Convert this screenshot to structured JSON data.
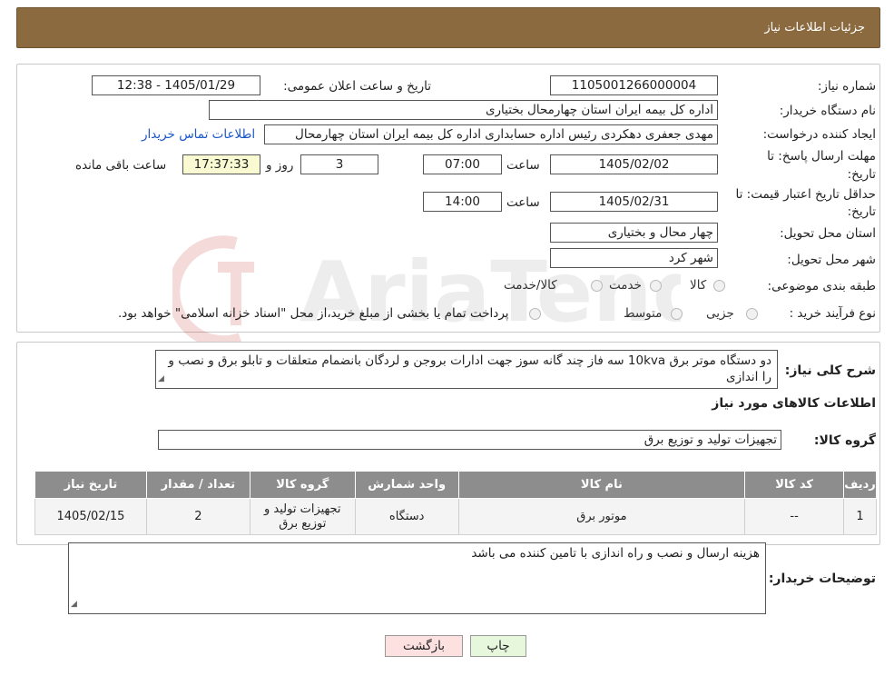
{
  "header": {
    "title": "جزئیات اطلاعات نیاز"
  },
  "form": {
    "need_number_label": "شماره نیاز:",
    "need_number": "1105001266000004",
    "announce_label": "تاریخ و ساعت اعلان عمومی:",
    "announce_value": "1405/01/29 - 12:38",
    "buyer_org_label": "نام دستگاه خریدار:",
    "buyer_org": "اداره کل بیمه ایران استان چهارمحال بختیاری",
    "creator_label": "ایجاد کننده درخواست:",
    "creator": "مهدی جعفری دهکردی رئیس اداره حسابداری اداره کل بیمه ایران استان چهارمحال",
    "contact_link": "اطلاعات تماس خریدار",
    "send_deadline_label_1": "مهلت ارسال پاسخ: تا",
    "send_deadline_label_2": "تاریخ:",
    "send_deadline_date": "1405/02/02",
    "time_label": "ساعت",
    "send_deadline_time": "07:00",
    "days_value": "3",
    "days_label": "روز و",
    "remaining_time": "17:37:33",
    "remaining_label": "ساعت باقی مانده",
    "price_validity_label_1": "حداقل تاریخ اعتبار قیمت: تا",
    "price_validity_label_2": "تاریخ:",
    "price_validity_date": "1405/02/31",
    "price_validity_time": "14:00",
    "province_label": "استان محل تحویل:",
    "province": "چهار محال و بختیاری",
    "city_label": "شهر محل تحویل:",
    "city": "شهر کرد",
    "category_label": "طبقه بندی موضوعی:",
    "category_options": [
      "کالا",
      "خدمت",
      "کالا/خدمت"
    ],
    "process_label": "نوع فرآیند خرید :",
    "process_options": [
      "جزیی",
      "متوسط"
    ],
    "process_note": "پرداخت تمام یا بخشی از مبلغ خرید،از محل \"اسناد خزانه اسلامی\" خواهد بود."
  },
  "description": {
    "label": "شرح کلی نیاز:",
    "text": "دو دستگاه موتر برق 10kva سه فاز چند گانه سوز جهت ادارات بروجن و لردگان بانضمام متعلقات و تابلو برق و نصب و را اندازی",
    "goods_info_title": "اطلاعات کالاهای مورد نیاز",
    "goods_group_label": "گروه کالا:",
    "goods_group": "تجهیزات تولید و توزیع برق"
  },
  "table": {
    "headers": [
      "ردیف",
      "کد کالا",
      "نام کالا",
      "واحد شمارش",
      "گروه کالا",
      "تعداد / مقدار",
      "تاریخ نیاز"
    ],
    "rows": [
      [
        "1",
        "--",
        "موتور برق",
        "دستگاه",
        "تجهیزات تولید و توزیع برق",
        "2",
        "1405/02/15"
      ]
    ]
  },
  "buyer_notes": {
    "label": "توضیحات خریدار:",
    "text": "هزینه ارسال و نصب و راه اندازی با تامین کننده می باشد"
  },
  "buttons": {
    "print": "چاپ",
    "back": "بازگشت"
  },
  "watermark": {
    "text": "AriaTender.neT"
  },
  "colors": {
    "header": "#8b6a40",
    "table_header": "#8d8d8d",
    "back_button": "#fde0e0",
    "print_button": "#e6f7dc",
    "link": "#1a56c9"
  }
}
